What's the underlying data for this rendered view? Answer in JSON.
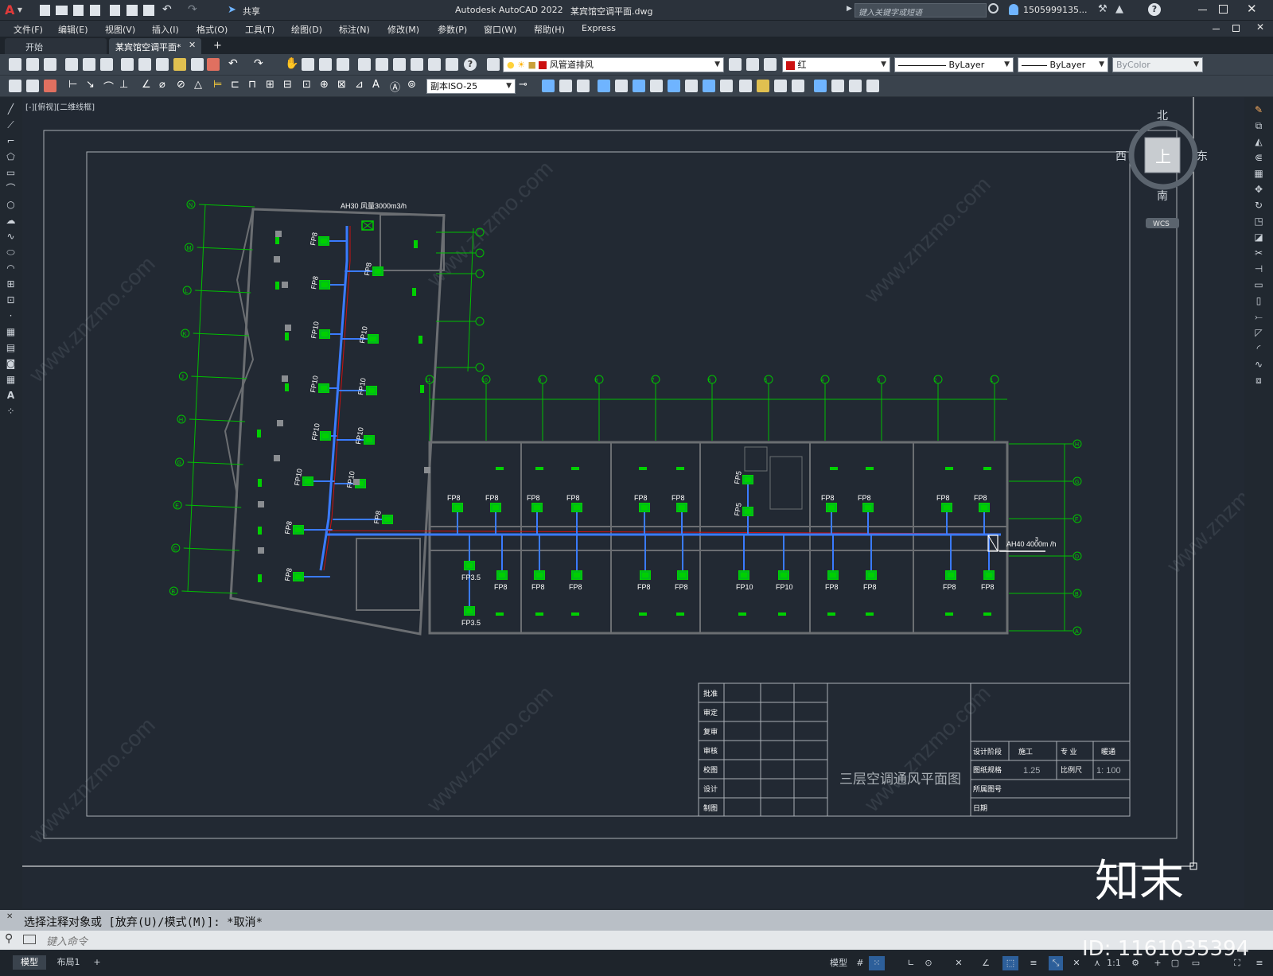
{
  "titlebar": {
    "app_name": "Autodesk AutoCAD 2022",
    "doc_name": "某宾馆空调平面.dwg",
    "share_label": "共享",
    "search_placeholder": "键入关键字或短语",
    "user_name": "1505999135...",
    "app_letter": "A"
  },
  "menu": {
    "items": [
      "文件(F)",
      "编辑(E)",
      "视图(V)",
      "插入(I)",
      "格式(O)",
      "工具(T)",
      "绘图(D)",
      "标注(N)",
      "修改(M)",
      "参数(P)",
      "窗口(W)",
      "帮助(H)",
      "Express"
    ]
  },
  "tabs": {
    "start": "开始",
    "active": "某宾馆空调平面*",
    "plus": "+"
  },
  "toolbar": {
    "layer_name": "风管道排风",
    "color_name": "红",
    "linetype": "ByLayer",
    "lineweight": "ByLayer",
    "plotstyle": "ByColor",
    "dimstyle": "副本ISO-25"
  },
  "viewport": {
    "label": "[-][俯视][二维线框]",
    "viewcube": {
      "north": "北",
      "south": "南",
      "east": "东",
      "west": "西",
      "top": "上",
      "wcs": "WCS"
    }
  },
  "drawing": {
    "top_label": "AH30  风量3000m3/h",
    "right_label": "AH40  4000m /h",
    "right_label_sup": "3",
    "fan_labels_left": [
      "FP8",
      "FP8",
      "FP8",
      "FP10",
      "FP10",
      "FP10",
      "FP10",
      "FP10",
      "FP10",
      "FP10",
      "FP10",
      "FP8",
      "FP8",
      "FP8"
    ],
    "fan_labels_upper": [
      "FP8",
      "FP8",
      "FP8",
      "FP8",
      "FP8",
      "FP8",
      "FP5",
      "FP5",
      "FP8",
      "FP8",
      "FP8",
      "FP8"
    ],
    "fan_labels_lower": [
      "FP3.5",
      "FP3.5",
      "FP8",
      "FP8",
      "FP8",
      "FP8",
      "FP8",
      "FP10",
      "FP10",
      "FP8",
      "FP8",
      "FP8",
      "FP8"
    ],
    "grid_left": [
      "N",
      "M",
      "L",
      "K",
      "J",
      "H",
      "G",
      "E",
      "C",
      "B"
    ],
    "grid_right": [
      "H",
      "G",
      "F",
      "D",
      "B",
      "A"
    ],
    "grid_top": [
      "11",
      "10",
      "9",
      "8",
      "7",
      "6",
      "5",
      "4",
      "3",
      "2",
      "1"
    ]
  },
  "titleblock": {
    "left_labels": [
      "批准",
      "审定",
      "复审",
      "审核",
      "校图",
      "设计",
      "制图"
    ],
    "drawing_title": "三层空调通风平面图",
    "design_stage_label": "设计阶段",
    "design_stage_value": "施工",
    "discipline_label": "专 业",
    "discipline_value": "暖通",
    "size_label": "图纸规格",
    "size_value": "1.25",
    "scale_label": "比例尺",
    "scale_value": "1: 100",
    "drawing_no_label": "所属图号",
    "date_label": "日期"
  },
  "watermark": {
    "text": "www.znzmo.com",
    "brand": "知末网",
    "logo_text": "知末",
    "id_text": "ID: 1161035394"
  },
  "command": {
    "history": "选择注释对象或 [放弃(U)/模式(M)]: *取消*",
    "input_placeholder": "键入命令"
  },
  "status": {
    "tabs": [
      "模型",
      "布局1",
      "+"
    ],
    "model_label": "模型",
    "scale": "1:1"
  },
  "colors": {
    "accent_red": "#cc1111",
    "cad_green": "#00d000",
    "duct_blue": "#3a7bff",
    "wall_gray": "#6b6e72",
    "bg": "#222933"
  }
}
